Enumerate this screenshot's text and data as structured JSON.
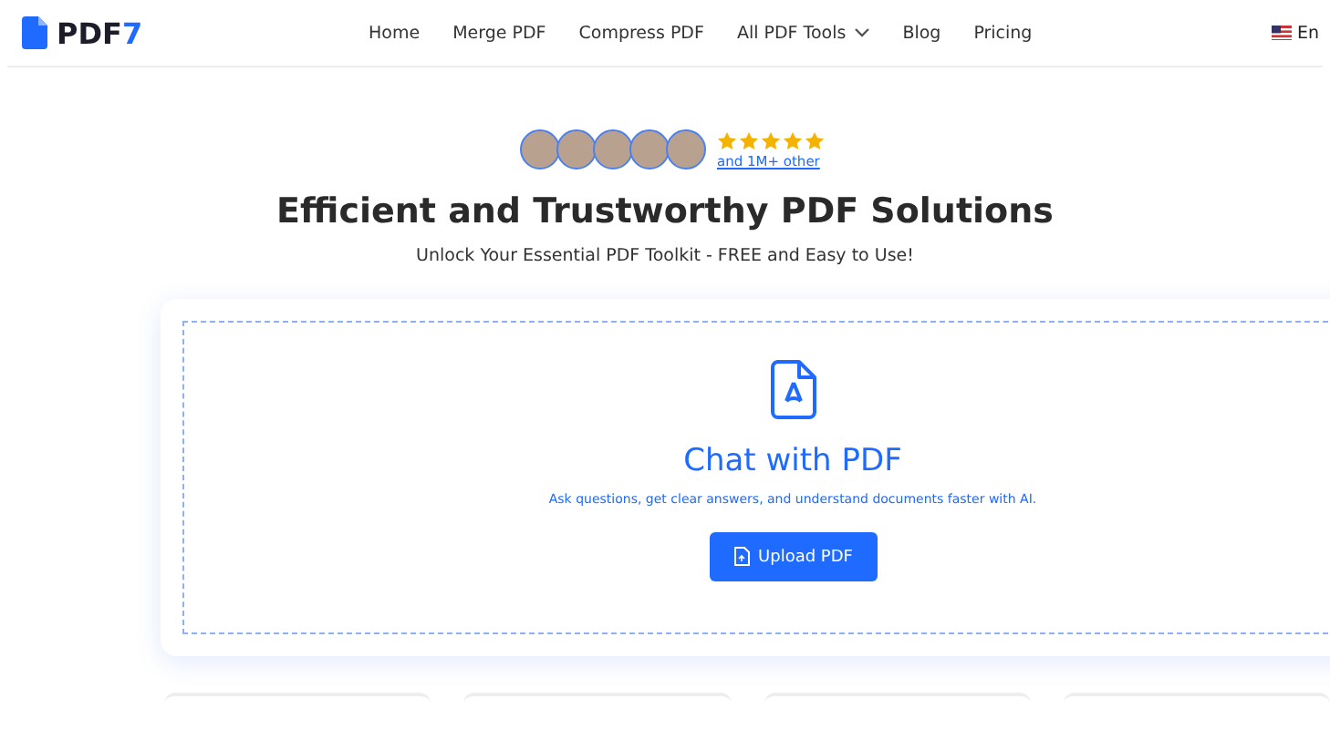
{
  "header": {
    "logo": {
      "text": "PDF",
      "accent": "7"
    },
    "nav": [
      {
        "label": "Home",
        "dropdown": false
      },
      {
        "label": "Merge PDF",
        "dropdown": false
      },
      {
        "label": "Compress PDF",
        "dropdown": false
      },
      {
        "label": "All PDF Tools",
        "dropdown": true
      },
      {
        "label": "Blog",
        "dropdown": false
      },
      {
        "label": "Pricing",
        "dropdown": false
      }
    ],
    "language": "En"
  },
  "hero": {
    "rating": {
      "stars": 5,
      "link": "and 1M+ other"
    },
    "title": "Efficient and Trustworthy PDF Solutions",
    "subtitle": "Unlock Your Essential PDF Toolkit - FREE and Easy to Use!"
  },
  "upload_card": {
    "title": "Chat with PDF",
    "description": "Ask questions, get clear answers, and understand documents faster with AI.",
    "button": "Upload PDF"
  }
}
